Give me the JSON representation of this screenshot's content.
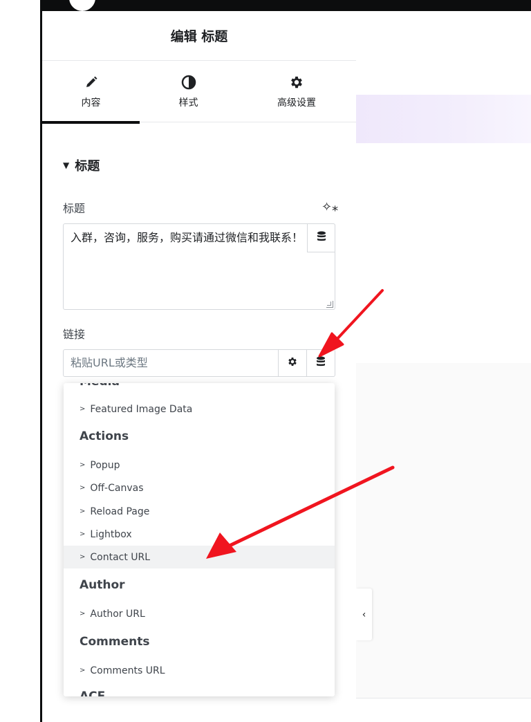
{
  "panel": {
    "title": "编辑 标题"
  },
  "tabs": [
    {
      "label": "内容",
      "icon": "pencil-icon",
      "active": true
    },
    {
      "label": "样式",
      "icon": "half-circle-icon",
      "active": false
    },
    {
      "label": "高级设置",
      "icon": "gear-icon",
      "active": false
    }
  ],
  "section": {
    "title": "标题"
  },
  "fields": {
    "title_label": "标题",
    "title_value": "入群，咨询，服务，购买请通过微信和我联系！",
    "link_label": "链接",
    "link_placeholder": "粘贴URL或类型"
  },
  "dropdown": {
    "cut_group": "Media",
    "items_media": [
      "Featured Image Data"
    ],
    "group_actions": "Actions",
    "items_actions": [
      "Popup",
      "Off-Canvas",
      "Reload Page",
      "Lightbox",
      "Contact URL"
    ],
    "group_author": "Author",
    "items_author": [
      "Author URL"
    ],
    "group_comments": "Comments",
    "items_comments": [
      "Comments URL"
    ],
    "cut_bottom": "ACF",
    "hovered": "Contact URL"
  },
  "colors": {
    "accent_arrow": "#f0151f",
    "dark": "#0c0d0e",
    "preview_band": "#efe8fb"
  }
}
